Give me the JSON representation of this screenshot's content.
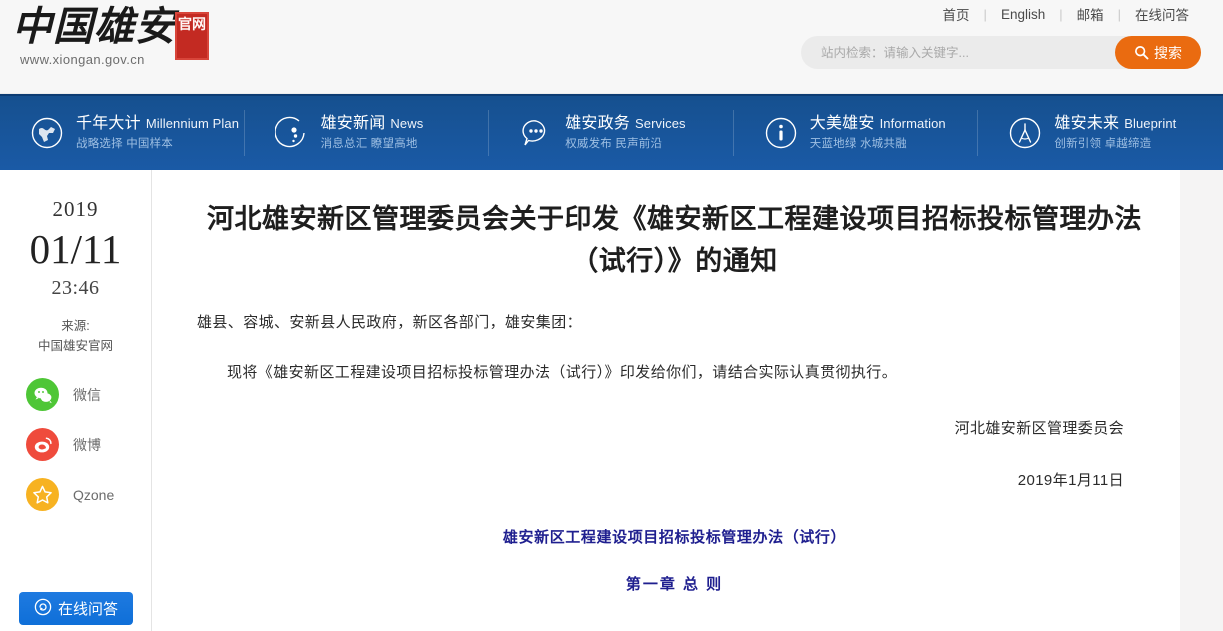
{
  "header": {
    "logo": {
      "calligraphy": "中国雄安",
      "seal": "官网",
      "url": "www.xiongan.gov.cn"
    },
    "top_links": [
      {
        "label": "首页"
      },
      {
        "label": "English"
      },
      {
        "label": "邮箱"
      },
      {
        "label": "在线问答"
      }
    ],
    "separator": "|",
    "search": {
      "placeholder": "站内检索：请输入关键字...",
      "value": "",
      "button_label": "搜索",
      "button_color": "#ea6b10",
      "icon": "search-icon"
    }
  },
  "navbar": {
    "background_color": "#17559c",
    "items": [
      {
        "icon": "globe-icon",
        "title": "千年大计",
        "en": "Millennium Plan",
        "sub": "战略选择 中国样本"
      },
      {
        "icon": "orbit-icon",
        "title": "雄安新闻",
        "en": "News",
        "sub": "消息总汇 瞭望高地"
      },
      {
        "icon": "chat-icon",
        "title": "雄安政务",
        "en": "Services",
        "sub": "权威发布 民声前沿"
      },
      {
        "icon": "info-icon",
        "title": "大美雄安",
        "en": "Information",
        "sub": "天蓝地绿 水城共融"
      },
      {
        "icon": "compass-icon",
        "title": "雄安未来",
        "en": "Blueprint",
        "sub": "创新引领 卓越缔造"
      }
    ]
  },
  "sidebar": {
    "year": "2019",
    "date": "01/11",
    "time": "23:46",
    "source_label": "来源:",
    "source_name": "中国雄安官网",
    "shares": [
      {
        "label": "微信",
        "icon": "wechat-icon",
        "color": "#4ec636"
      },
      {
        "label": "微博",
        "icon": "weibo-icon",
        "color": "#ef4b3c"
      },
      {
        "label": "Qzone",
        "icon": "qzone-icon",
        "color": "#f7b221"
      }
    ],
    "qa_button": {
      "label": "在线问答",
      "icon": "headset-icon",
      "color": "#0f6fd8"
    }
  },
  "article": {
    "title": "河北雄安新区管理委员会关于印发《雄安新区工程建设项目招标投标管理办法（试行）》的通知",
    "recipients": "雄县、容城、安新县人民政府，新区各部门，雄安集团：",
    "body": "现将《雄安新区工程建设项目招标投标管理办法（试行）》印发给你们，请结合实际认真贯彻执行。",
    "signature": "河北雄安新区管理委员会",
    "sign_date": "2019年1月11日",
    "doc_title": "雄安新区工程建设项目招标投标管理办法（试行）",
    "chapter": "第一章 总 则",
    "heading_color": "#1f1f8f"
  }
}
